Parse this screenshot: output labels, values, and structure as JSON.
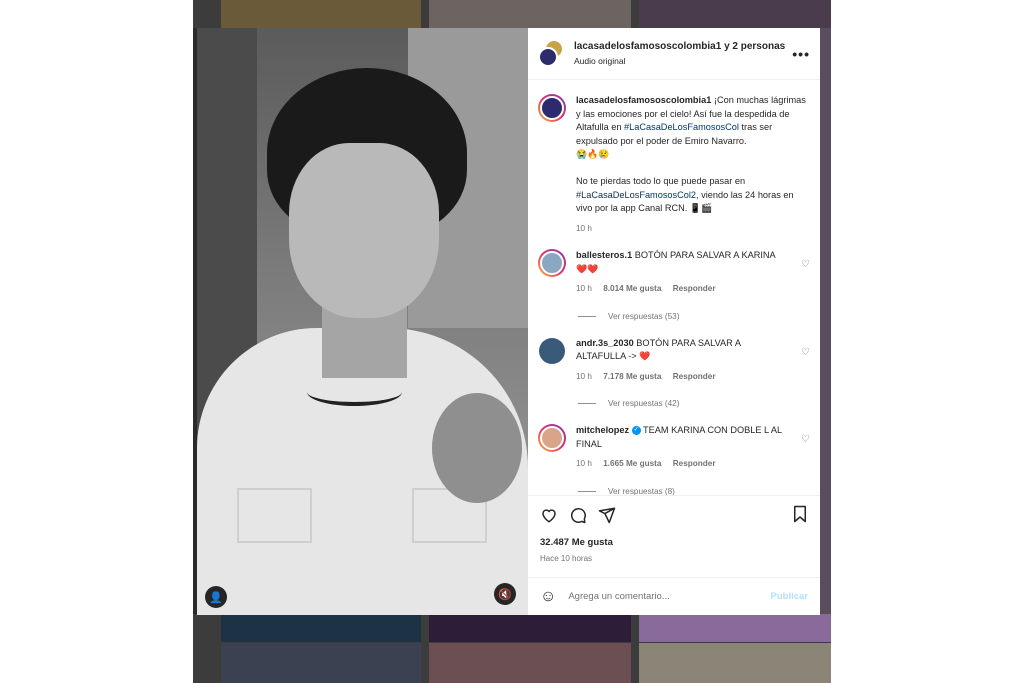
{
  "post": {
    "header_title": "lacasadelosfamososcolombia1 y 2 personas m",
    "header_subtitle": "Audio original",
    "more_label": "•••"
  },
  "caption": {
    "user": "lacasadelosfamososcolombia1",
    "text_1": "¡Con muchas lágrimas y las emociones por el cielo! Así fue la despedida de Altafulla en",
    "hashtag_1": "#LaCasaDeLosFamososCol",
    "text_2": "tras ser expulsado por el poder de Emiro Navarro.",
    "emojis_1": "😭🔥😢",
    "text_3": "No te pierdas todo lo que puede pasar en",
    "hashtag_2": "#LaCasaDeLosFamososCol2",
    "text_4": ", viendo las 24 horas en vivo por la app Canal RCN.",
    "emojis_2": "📱🎬",
    "time": "10 h"
  },
  "comments": [
    {
      "user": "ballesteros.1",
      "text": "BOTÓN PARA SALVAR A KARINA",
      "emojis": "❤️❤️",
      "time": "10 h",
      "likes": "8.014 Me gusta",
      "reply": "Responder",
      "replies": "Ver respuestas (53)",
      "color": "#8aa6c1"
    },
    {
      "user": "andr.3s_2030",
      "text": "BOTÓN PARA SALVAR A ALTAFULLA ->",
      "emojis": "❤️",
      "time": "10 h",
      "likes": "7.178 Me gusta",
      "reply": "Responder",
      "replies": "Ver respuestas (42)",
      "color": "#3a5a7a"
    },
    {
      "user": "mitchelopez",
      "text": "TEAM KARINA CON DOBLE L AL FINAL",
      "verified": "✓",
      "time": "10 h",
      "likes": "1.665 Me gusta",
      "reply": "Responder",
      "replies": "Ver respuestas (8)",
      "color": "#d9a48a"
    }
  ],
  "actions": {
    "likes": "32.487 Me gusta",
    "time_ago": "Hace 10 horas"
  },
  "comment_input": {
    "emoji_icon": "☺",
    "placeholder": "Agrega un comentario...",
    "publish": "Publicar"
  },
  "media": {
    "user_icon": "👤",
    "mute_icon": "🔇"
  },
  "colors": {
    "link": "#00376b",
    "accent": "#0095f6",
    "muted": "#737373"
  }
}
